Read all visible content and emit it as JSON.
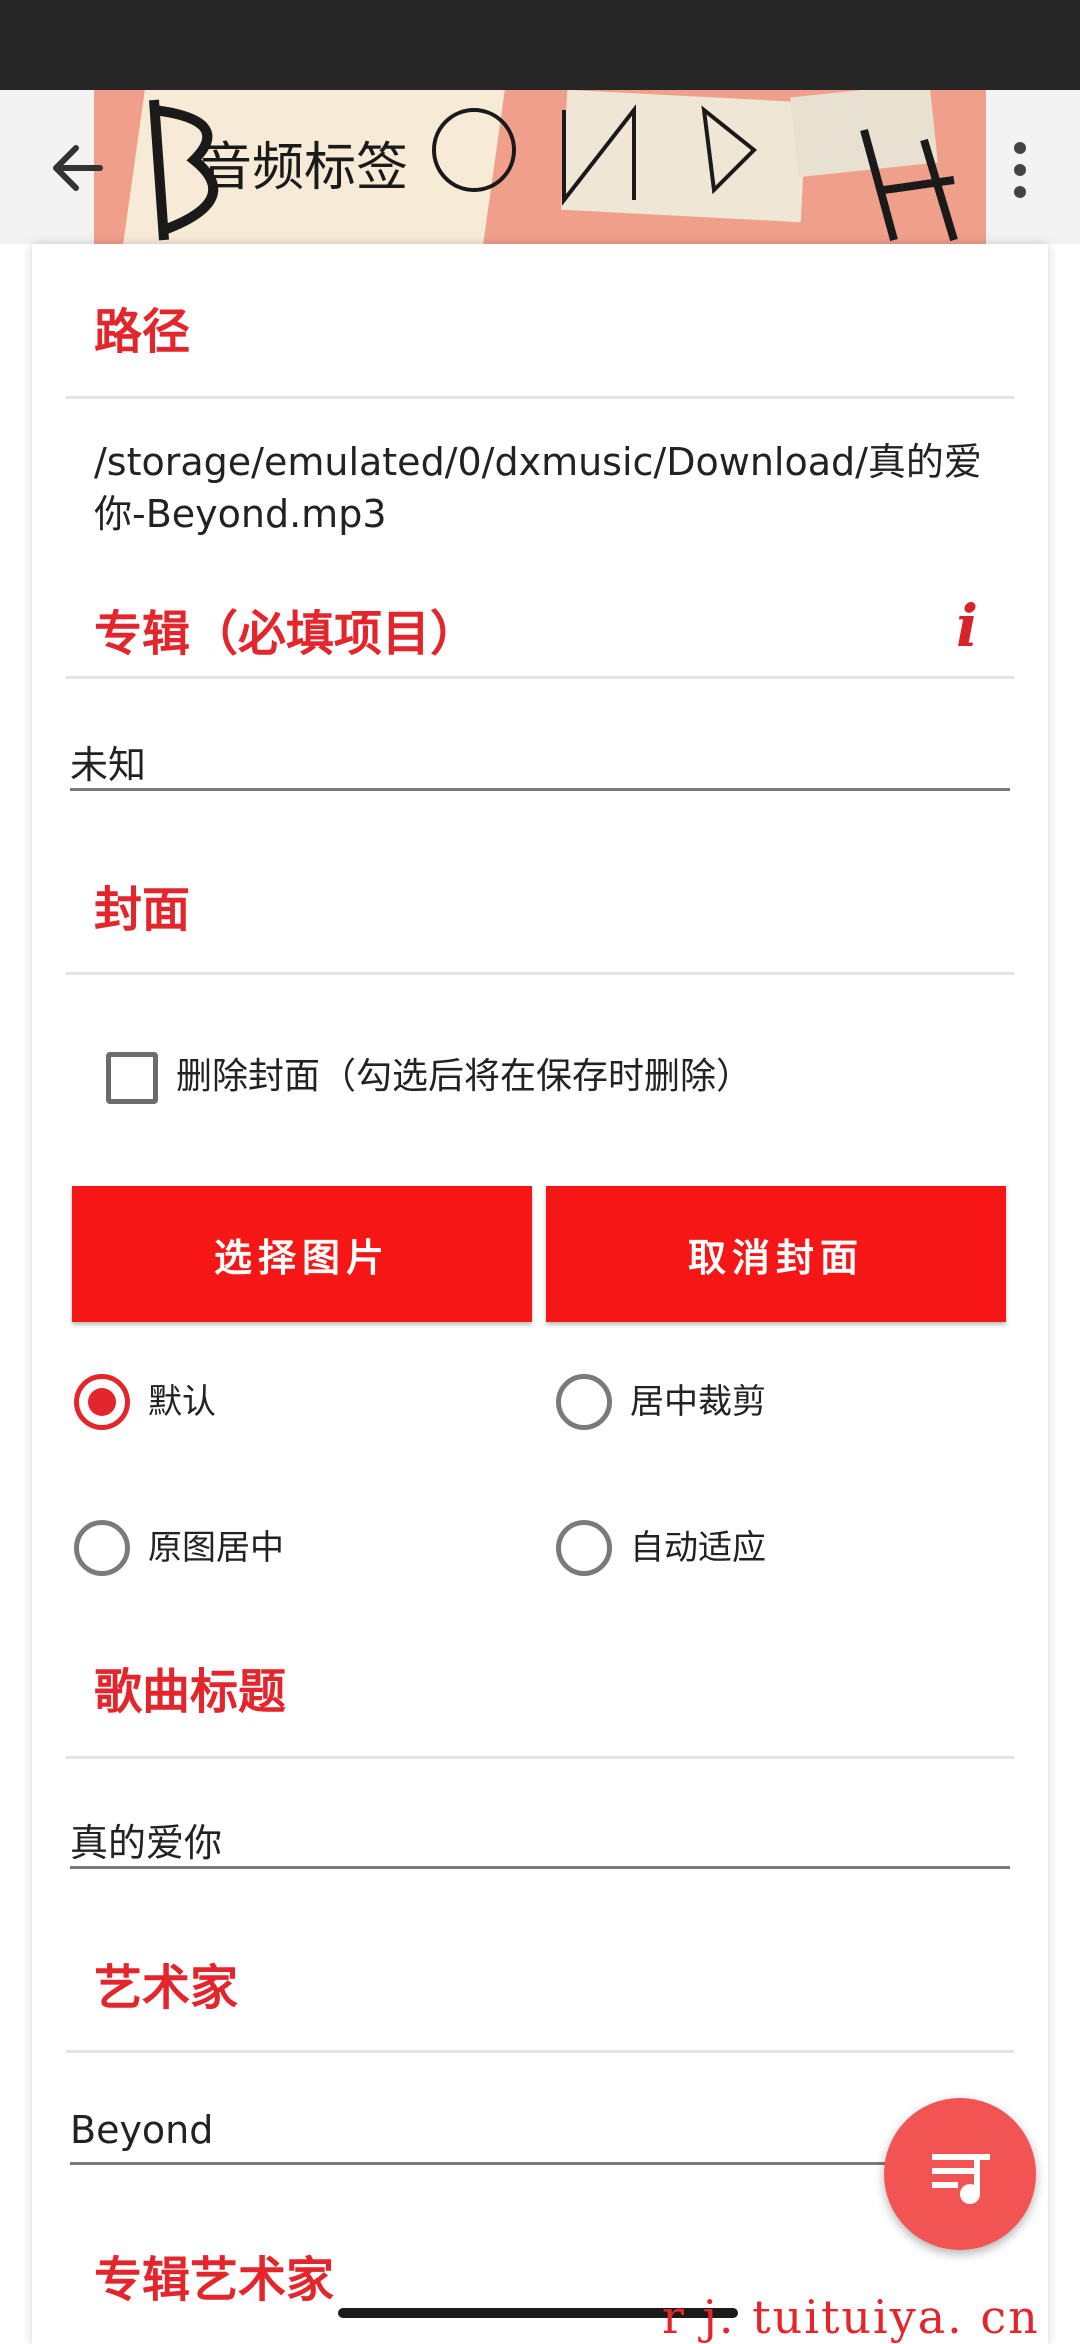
{
  "appbar": {
    "title": "音频标签"
  },
  "sections": {
    "path": {
      "title": "路径",
      "value": "/storage/emulated/0/dxmusic/Download/真的爱你-Beyond.mp3"
    },
    "album": {
      "title": "专辑（必填项目）",
      "info_icon": "i",
      "value": "未知"
    },
    "cover": {
      "title": "封面",
      "delete_checkbox": {
        "label": "删除封面（勾选后将在保存时删除）",
        "checked": false
      },
      "buttons": {
        "select": "选择图片",
        "cancel": "取消封面"
      },
      "modes": [
        {
          "label": "默认",
          "selected": true
        },
        {
          "label": "居中裁剪",
          "selected": false
        },
        {
          "label": "原图居中",
          "selected": false
        },
        {
          "label": "自动适应",
          "selected": false
        }
      ]
    },
    "song_title": {
      "title": "歌曲标题",
      "value": "真的爱你"
    },
    "artist": {
      "title": "艺术家",
      "value": "Beyond"
    },
    "album_artist": {
      "title": "专辑艺术家"
    }
  },
  "watermark": "r j. tuituiya. cn",
  "colors": {
    "accent": "#e3262c",
    "button": "#f71616",
    "fab": "#f25454"
  },
  "icons": {
    "back": "arrow-back-icon",
    "overflow": "more-vert-icon",
    "fab": "playlist-music-icon"
  }
}
